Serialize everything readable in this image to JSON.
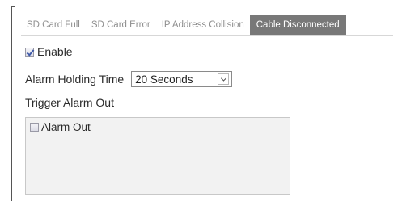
{
  "tabs": [
    {
      "label": "SD Card Full",
      "active": false
    },
    {
      "label": "SD Card Error",
      "active": false
    },
    {
      "label": "IP Address Collision",
      "active": false
    },
    {
      "label": "Cable Disconnected",
      "active": true
    }
  ],
  "enable": {
    "label": "Enable",
    "checked": true
  },
  "alarm_holding_time": {
    "label": "Alarm Holding Time",
    "value": "20 Seconds"
  },
  "trigger_alarm_out": {
    "title": "Trigger Alarm Out",
    "items": [
      {
        "label": "Alarm Out",
        "checked": false
      }
    ]
  },
  "colors": {
    "active_tab_bg": "#787878",
    "inactive_tab_text": "#8e8e8e",
    "panel_bg": "#f2f2f2"
  }
}
